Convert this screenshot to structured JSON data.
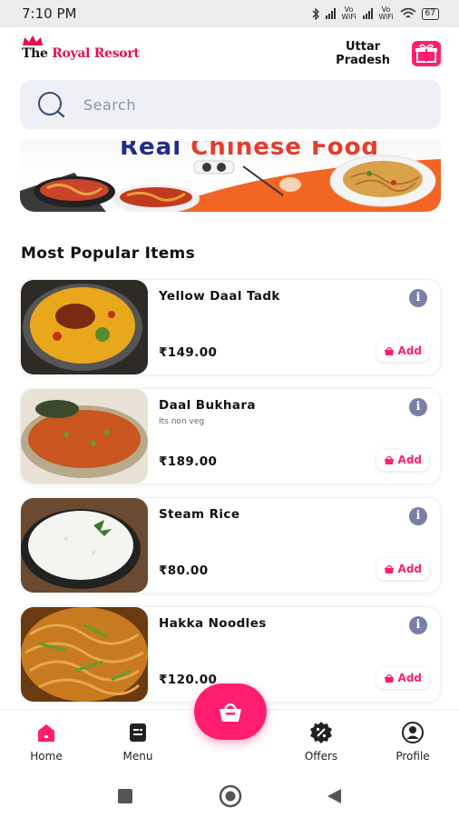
{
  "status": {
    "time": "7:10 PM",
    "battery": "67",
    "volte1": "Vo WiFi",
    "volte2": "Vo WiFi"
  },
  "header": {
    "brand_prefix": "The",
    "brand_name": "Royal Resort",
    "location_line1": "Uttar",
    "location_line2": "Pradesh"
  },
  "search": {
    "placeholder": "Search"
  },
  "banner": {
    "word1": "Real",
    "word2": "Chinese Food"
  },
  "section": {
    "title": "Most Popular Items"
  },
  "items": [
    {
      "name": "Yellow Daal Tadk",
      "desc": "",
      "price": "₹149.00",
      "add": "Add"
    },
    {
      "name": "Daal Bukhara",
      "desc": "Its non veg",
      "price": "₹189.00",
      "add": "Add"
    },
    {
      "name": "Steam Rice",
      "desc": "",
      "price": "₹80.00",
      "add": "Add"
    },
    {
      "name": "Hakka Noodles",
      "desc": "",
      "price": "₹120.00",
      "add": "Add"
    }
  ],
  "nav": {
    "home": "Home",
    "menu": "Menu",
    "offers": "Offers",
    "profile": "Profile"
  },
  "colors": {
    "accent": "#ff1e6e",
    "info": "#7a7fa5",
    "search_bg": "#eef0f5"
  }
}
